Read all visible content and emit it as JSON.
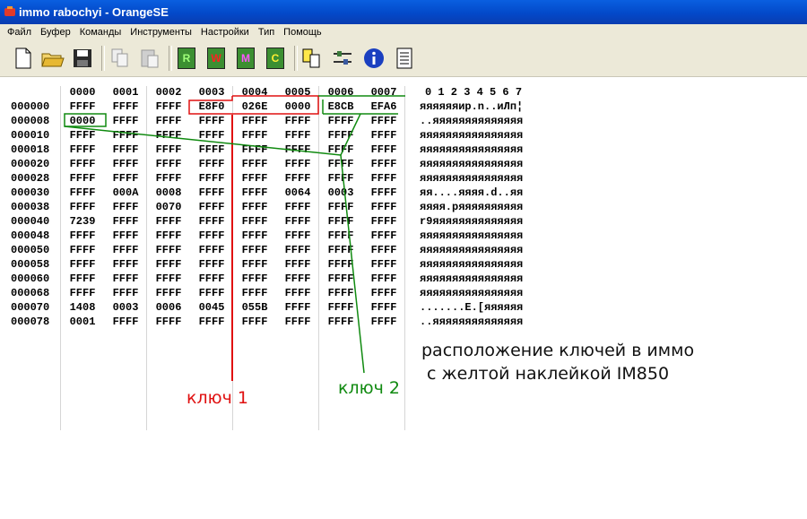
{
  "window": {
    "title": "immo rabochyi - OrangeSE"
  },
  "menu": [
    "Файл",
    "Буфер",
    "Команды",
    "Инструменты",
    "Настройки",
    "Тип",
    "Помощь"
  ],
  "toolbar": {
    "buttons": [
      "new-file-icon",
      "open-folder-icon",
      "save-icon",
      "copy-icon",
      "paste-icon",
      "read-chip-icon",
      "write-chip-icon",
      "modify-chip-icon",
      "compare-chip-icon",
      "chip-select-icon",
      "settings-icon",
      "info-icon",
      "hex-view-icon"
    ],
    "chip_letters": [
      "R",
      "W",
      "M",
      "C"
    ]
  },
  "hex": {
    "columns": [
      "0000",
      "0001",
      "0002",
      "0003",
      "0004",
      "0005",
      "0006",
      "0007"
    ],
    "ascii_header": "0 1 2 3 4 5 6 7",
    "rows": [
      {
        "offset": "000000",
        "cells": [
          "FFFF",
          "FFFF",
          "FFFF",
          "E8F0",
          "026E",
          "0000",
          "E8CB",
          "EFA6"
        ],
        "ascii": "яяяяяяир.n..иЛп¦"
      },
      {
        "offset": "000008",
        "cells": [
          "0000",
          "FFFF",
          "FFFF",
          "FFFF",
          "FFFF",
          "FFFF",
          "FFFF",
          "FFFF"
        ],
        "ascii": "..яяяяяяяяяяяяяя"
      },
      {
        "offset": "000010",
        "cells": [
          "FFFF",
          "FFFF",
          "FFFF",
          "FFFF",
          "FFFF",
          "FFFF",
          "FFFF",
          "FFFF"
        ],
        "ascii": "яяяяяяяяяяяяяяяя"
      },
      {
        "offset": "000018",
        "cells": [
          "FFFF",
          "FFFF",
          "FFFF",
          "FFFF",
          "FFFF",
          "FFFF",
          "FFFF",
          "FFFF"
        ],
        "ascii": "яяяяяяяяяяяяяяяя"
      },
      {
        "offset": "000020",
        "cells": [
          "FFFF",
          "FFFF",
          "FFFF",
          "FFFF",
          "FFFF",
          "FFFF",
          "FFFF",
          "FFFF"
        ],
        "ascii": "яяяяяяяяяяяяяяяя"
      },
      {
        "offset": "000028",
        "cells": [
          "FFFF",
          "FFFF",
          "FFFF",
          "FFFF",
          "FFFF",
          "FFFF",
          "FFFF",
          "FFFF"
        ],
        "ascii": "яяяяяяяяяяяяяяяя"
      },
      {
        "offset": "000030",
        "cells": [
          "FFFF",
          "000A",
          "0008",
          "FFFF",
          "FFFF",
          "0064",
          "0003",
          "FFFF"
        ],
        "ascii": "яя....яяяя.d..яя"
      },
      {
        "offset": "000038",
        "cells": [
          "FFFF",
          "FFFF",
          "0070",
          "FFFF",
          "FFFF",
          "FFFF",
          "FFFF",
          "FFFF"
        ],
        "ascii": "яяяя.pяяяяяяяяяя"
      },
      {
        "offset": "000040",
        "cells": [
          "7239",
          "FFFF",
          "FFFF",
          "FFFF",
          "FFFF",
          "FFFF",
          "FFFF",
          "FFFF"
        ],
        "ascii": "r9яяяяяяяяяяяяяя"
      },
      {
        "offset": "000048",
        "cells": [
          "FFFF",
          "FFFF",
          "FFFF",
          "FFFF",
          "FFFF",
          "FFFF",
          "FFFF",
          "FFFF"
        ],
        "ascii": "яяяяяяяяяяяяяяяя"
      },
      {
        "offset": "000050",
        "cells": [
          "FFFF",
          "FFFF",
          "FFFF",
          "FFFF",
          "FFFF",
          "FFFF",
          "FFFF",
          "FFFF"
        ],
        "ascii": "яяяяяяяяяяяяяяяя"
      },
      {
        "offset": "000058",
        "cells": [
          "FFFF",
          "FFFF",
          "FFFF",
          "FFFF",
          "FFFF",
          "FFFF",
          "FFFF",
          "FFFF"
        ],
        "ascii": "яяяяяяяяяяяяяяяя"
      },
      {
        "offset": "000060",
        "cells": [
          "FFFF",
          "FFFF",
          "FFFF",
          "FFFF",
          "FFFF",
          "FFFF",
          "FFFF",
          "FFFF"
        ],
        "ascii": "яяяяяяяяяяяяяяяя"
      },
      {
        "offset": "000068",
        "cells": [
          "FFFF",
          "FFFF",
          "FFFF",
          "FFFF",
          "FFFF",
          "FFFF",
          "FFFF",
          "FFFF"
        ],
        "ascii": "яяяяяяяяяяяяяяяя"
      },
      {
        "offset": "000070",
        "cells": [
          "1408",
          "0003",
          "0006",
          "0045",
          "055B",
          "FFFF",
          "FFFF",
          "FFFF"
        ],
        "ascii": ".......E.[яяяяяя"
      },
      {
        "offset": "000078",
        "cells": [
          "0001",
          "FFFF",
          "FFFF",
          "FFFF",
          "FFFF",
          "FFFF",
          "FFFF",
          "FFFF"
        ],
        "ascii": "..яяяяяяяяяяяяяя"
      }
    ]
  },
  "annotations": {
    "key1": "ключ 1",
    "key2": "ключ 2",
    "caption_line1": "расположение ключей в иммо",
    "caption_line2": " с желтой наклейкой IM850"
  },
  "colors": {
    "key1": "#e01010",
    "key2": "#108a10",
    "titlebar": "#0349c9"
  }
}
